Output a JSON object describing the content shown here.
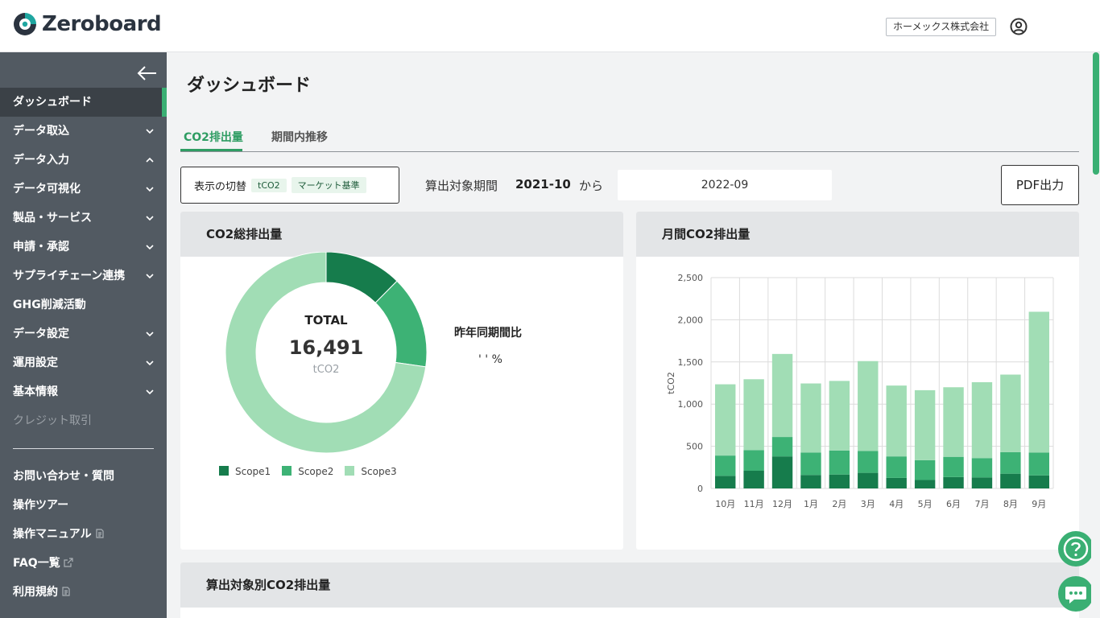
{
  "header": {
    "logo_text": "Zeroboard",
    "company": "ホーメックス株式会社",
    "user_icon": "user-circle-icon"
  },
  "sidebar": {
    "items": [
      {
        "label": "ダッシュボード",
        "active": true,
        "chevron": null
      },
      {
        "label": "データ取込",
        "chevron": "down"
      },
      {
        "label": "データ入力",
        "chevron": "up"
      },
      {
        "label": "データ可視化",
        "chevron": "down"
      },
      {
        "label": "製品・サービス",
        "chevron": "down"
      },
      {
        "label": "申請・承認",
        "chevron": "down"
      },
      {
        "label": "サプライチェーン連携",
        "chevron": "down"
      },
      {
        "label": "GHG削減活動",
        "chevron": null
      },
      {
        "label": "データ設定",
        "chevron": "down"
      },
      {
        "label": "運用設定",
        "chevron": "down"
      },
      {
        "label": "基本情報",
        "chevron": "down"
      },
      {
        "label": "クレジット取引",
        "disabled": true
      }
    ],
    "footer_items": [
      {
        "label": "お問い合わせ・質問"
      },
      {
        "label": "操作ツアー"
      },
      {
        "label": "操作マニュアル",
        "icon": "document-icon"
      },
      {
        "label": "FAQ一覧",
        "icon": "external-link-icon"
      },
      {
        "label": "利用規約",
        "icon": "document-icon"
      }
    ]
  },
  "main": {
    "title": "ダッシュボード",
    "tabs": [
      {
        "label": "CO2排出量",
        "active": true
      },
      {
        "label": "期間内推移"
      }
    ],
    "toggle": {
      "label": "表示の切替",
      "chip1": "tCO2",
      "chip2": "マーケット基準"
    },
    "period": {
      "label": "算出対象期間",
      "from": "2021-10",
      "kara": "から",
      "to": "2022-09"
    },
    "pdf_button": "PDF出力",
    "total_card": {
      "title": "CO2総排出量",
      "total_label": "TOTAL",
      "total_value": "16,491",
      "total_unit": "tCO2",
      "yoy_title": "昨年同期間比",
      "yoy_value": "' ' %"
    },
    "monthly_card": {
      "title": "月間CO2排出量"
    },
    "target_card": {
      "title": "算出対象別CO2排出量"
    }
  },
  "colors": {
    "scope1": "#167c4c",
    "scope2": "#3db275",
    "scope3": "#a1ddb5",
    "accent": "#3aaf73"
  },
  "chart_data": [
    {
      "type": "pie",
      "subtype": "donut",
      "labels": [
        "Scope1",
        "Scope2",
        "Scope3"
      ],
      "values": [
        2050,
        2450,
        11991
      ],
      "total": 16491,
      "unit": "tCO2"
    },
    {
      "type": "bar",
      "stacked": true,
      "categories": [
        "10月",
        "11月",
        "12月",
        "1月",
        "2月",
        "3月",
        "4月",
        "5月",
        "6月",
        "7月",
        "8月",
        "9月"
      ],
      "series": [
        {
          "name": "Scope1",
          "values": [
            150,
            210,
            380,
            160,
            165,
            185,
            125,
            100,
            135,
            130,
            175,
            155
          ]
        },
        {
          "name": "Scope2",
          "values": [
            240,
            245,
            230,
            265,
            285,
            260,
            255,
            235,
            240,
            230,
            255,
            270
          ]
        },
        {
          "name": "Scope3",
          "values": [
            845,
            840,
            985,
            820,
            825,
            1065,
            840,
            830,
            825,
            900,
            920,
            1670
          ]
        }
      ],
      "ylabel": "tCO2",
      "ylim": [
        0,
        2500
      ],
      "yticks": [
        "0",
        "500",
        "1,000",
        "1,500",
        "2,000",
        "2,500"
      ],
      "grid": true
    }
  ]
}
